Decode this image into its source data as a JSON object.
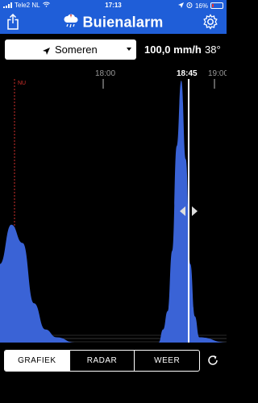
{
  "status": {
    "carrier": "Tele2 NL",
    "time": "17:13",
    "battery": "16%"
  },
  "header": {
    "title": "Buienalarm"
  },
  "location": {
    "name": "Someren"
  },
  "weather": {
    "rain_rate": "100,0 mm/h",
    "temperature": "38°"
  },
  "chart_data": {
    "type": "area",
    "now_label": "NU",
    "time_labels": [
      "18:00",
      "18:45",
      "19:00"
    ],
    "current_time_label": "18:45",
    "series": [
      {
        "points_desc": "relative rain intensity profile",
        "x": [
          0,
          0.05,
          0.1,
          0.15,
          0.2,
          0.25,
          0.33,
          0.45,
          0.55,
          0.7,
          0.72,
          0.74,
          0.76,
          0.78,
          0.8,
          0.82,
          0.84,
          0.86,
          0.88,
          1
        ],
        "y": [
          0.3,
          0.45,
          0.38,
          0.15,
          0.05,
          0.02,
          0.0,
          0.0,
          0.0,
          0.0,
          0.05,
          0.12,
          0.35,
          0.75,
          1.0,
          0.7,
          0.3,
          0.1,
          0.02,
          0.0
        ]
      }
    ],
    "color": "#3a63d6"
  },
  "tabs": [
    {
      "label": "GRAFIEK",
      "active": true
    },
    {
      "label": "RADAR",
      "active": false
    },
    {
      "label": "WEER",
      "active": false
    }
  ]
}
